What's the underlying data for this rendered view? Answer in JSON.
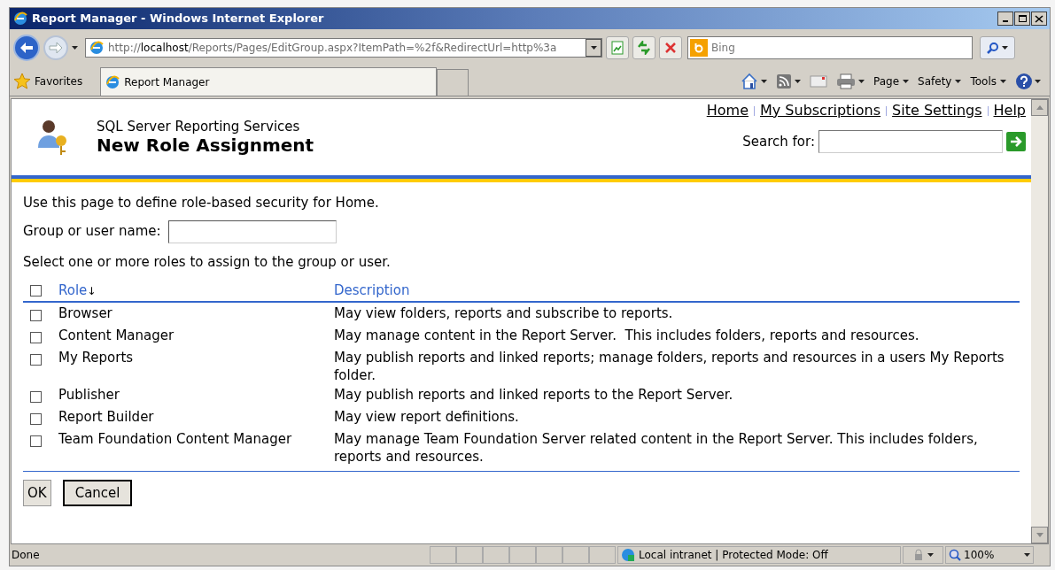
{
  "window": {
    "title": "Report Manager - Windows Internet Explorer"
  },
  "address_bar": {
    "url_host_prefix": "http://",
    "url_host": "localhost",
    "url_rest": "/Reports/Pages/EditGroup.aspx?ItemPath=%2f&RedirectUrl=http%3a"
  },
  "search_box": {
    "placeholder": "Bing"
  },
  "favorites": {
    "label": "Favorites"
  },
  "tabs": [
    {
      "label": "Report Manager",
      "selected": true
    }
  ],
  "command_bar": [
    "Page",
    "Safety",
    "Tools"
  ],
  "page": {
    "product": "SQL Server Reporting Services",
    "title": "New Role Assignment",
    "links": [
      "Home",
      "My Subscriptions",
      "Site Settings",
      "Help"
    ],
    "search_label": "Search for:",
    "intro": "Use this page to define role-based security for Home.",
    "name_label": "Group or user name:",
    "instruction": "Select one or more roles to assign to the group or user.",
    "table": {
      "select_all_checked": false,
      "columns": [
        {
          "label": "Role",
          "sort_mark": "↓"
        },
        {
          "label": "Description"
        }
      ],
      "rows": [
        {
          "role": "Browser",
          "description": "May view folders, reports and subscribe to reports.",
          "checked": false
        },
        {
          "role": "Content Manager",
          "description": "May manage content in the Report Server.  This includes folders, reports and resources.",
          "checked": false
        },
        {
          "role": "My Reports",
          "description": "May publish reports and linked reports; manage folders, reports and resources in a users My Reports folder.",
          "checked": false
        },
        {
          "role": "Publisher",
          "description": "May publish reports and linked reports to the Report Server.",
          "checked": false
        },
        {
          "role": "Report Builder",
          "description": "May view report definitions.",
          "checked": false
        },
        {
          "role": "Team Foundation Content Manager",
          "description": "May manage Team Foundation Server related content in the Report Server. This includes folders, reports and resources.",
          "checked": false
        }
      ]
    },
    "buttons": [
      "OK",
      "Cancel"
    ]
  },
  "status_bar": {
    "text": "Done",
    "zone": "Local intranet | Protected Mode: Off",
    "zoom": "100%"
  }
}
